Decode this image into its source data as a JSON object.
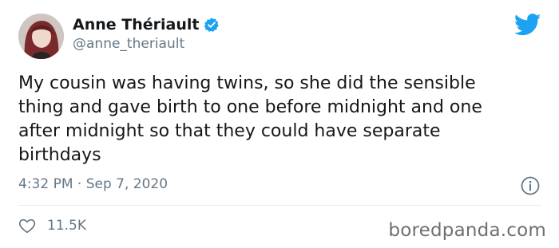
{
  "author": {
    "display_name": "Anne Thériault",
    "handle": "@anne_theriault",
    "avatar_icon": "profile-photo",
    "verified_icon": "verified-badge-icon"
  },
  "tweet": {
    "text": "My cousin was having twins, so she did the sensible\nthing and gave birth to one before midnight and one\nafter midnight so that they could have separate\nbirthdays",
    "time": "4:32 PM",
    "separator": "·",
    "date": "Sep 7, 2020"
  },
  "actions": {
    "like_icon": "heart-icon",
    "like_count": "11.5K",
    "info_icon": "info-icon"
  },
  "branding": {
    "platform_icon": "twitter-bird-icon",
    "watermark": "boredpanda.com"
  },
  "colors": {
    "twitter_blue": "#1da1f2",
    "secondary_text": "#657786",
    "primary_text": "#14171a",
    "divider": "#e6ecf0"
  }
}
